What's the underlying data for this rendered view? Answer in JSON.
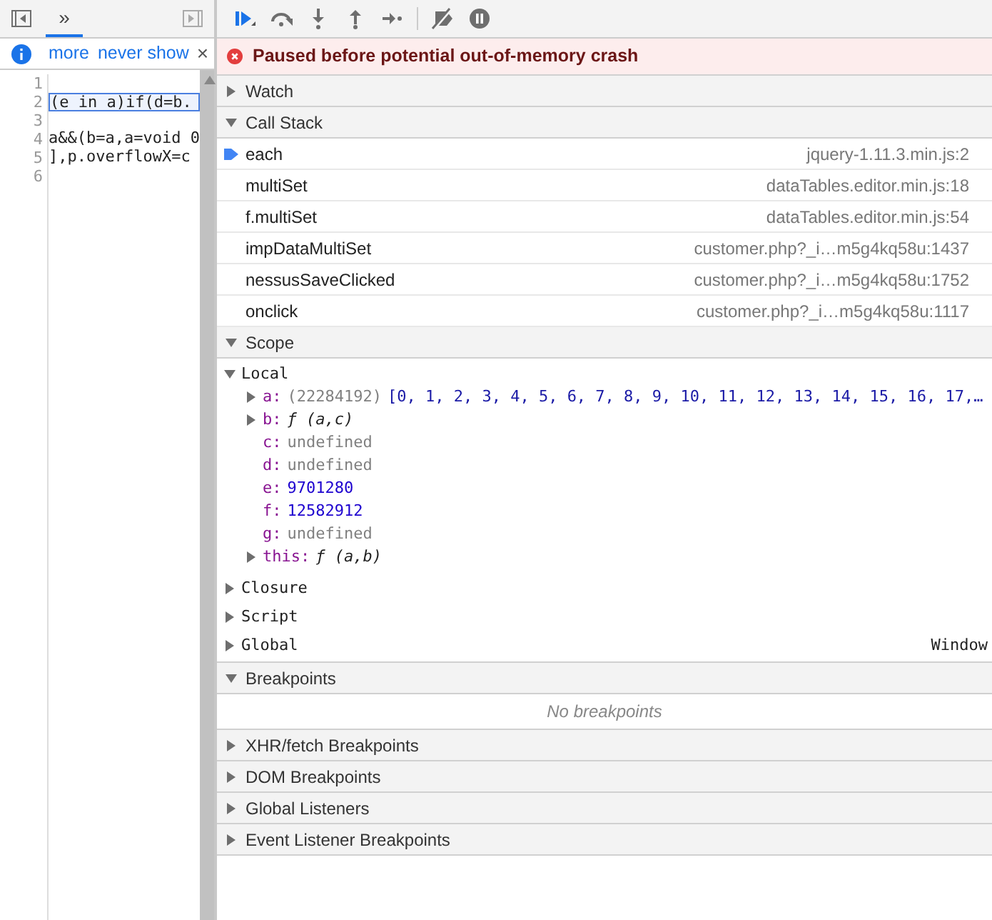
{
  "navigator": {
    "more_tabs": "»"
  },
  "info_bar": {
    "links": [
      "more",
      "never show"
    ],
    "close": "×"
  },
  "code": {
    "lines": [
      {
        "number": "1",
        "selected": false
      },
      {
        "number": "2",
        "text": "(e in a)if(d=b.",
        "selected": true
      },
      {
        "number": "3",
        "selected": false
      },
      {
        "number": "4",
        "text": "a&&(b=a,a=void 0",
        "selected": false
      },
      {
        "number": "5",
        "text": "],p.overflowX=c",
        "selected": false
      },
      {
        "number": "6",
        "selected": false
      }
    ]
  },
  "pause_banner": "Paused before potential out-of-memory crash",
  "sections": [
    {
      "kind": "plain",
      "title": "Watch",
      "expanded": false
    },
    {
      "kind": "call_stack",
      "title": "Call Stack",
      "expanded": true,
      "frames": [
        {
          "name": "each",
          "location": "jquery-1.11.3.min.js:2",
          "selected": true
        },
        {
          "name": "multiSet",
          "location": "dataTables.editor.min.js:18",
          "selected": false
        },
        {
          "name": "f.multiSet",
          "location": "dataTables.editor.min.js:54",
          "selected": false
        },
        {
          "name": "impDataMultiSet",
          "location": "customer.php?_i…m5g4kq58u:1437",
          "selected": false
        },
        {
          "name": "nessusSaveClicked",
          "location": "customer.php?_i…m5g4kq58u:1752",
          "selected": false
        },
        {
          "name": "onclick",
          "location": "customer.php?_i…m5g4kq58u:1117",
          "selected": false
        }
      ]
    },
    {
      "kind": "scope",
      "title": "Scope",
      "expanded": true,
      "scopes": [
        {
          "name": "Local",
          "expanded": true,
          "variables": [
            {
              "name": "a:",
              "kind": "array",
              "expandable": true,
              "count": "(22284192)",
              "value": "[0, 1, 2, 3, 4, 5, 6, 7, 8, 9, 10, 11, 12, 13, 14, 15, 16, 17,…"
            },
            {
              "name": "b:",
              "kind": "function",
              "expandable": true,
              "value": "ƒ (a,c)"
            },
            {
              "name": "c:",
              "kind": "undefined",
              "expandable": false,
              "value": "undefined"
            },
            {
              "name": "d:",
              "kind": "undefined",
              "expandable": false,
              "value": "undefined"
            },
            {
              "name": "e:",
              "kind": "number",
              "expandable": false,
              "value": "9701280"
            },
            {
              "name": "f:",
              "kind": "number",
              "expandable": false,
              "value": "12582912"
            },
            {
              "name": "g:",
              "kind": "undefined",
              "expandable": false,
              "value": "undefined"
            },
            {
              "name": "this:",
              "kind": "function",
              "expandable": true,
              "value": "ƒ (a,b)"
            }
          ]
        },
        {
          "name": "Closure",
          "expanded": false
        },
        {
          "name": "Script",
          "expanded": false
        },
        {
          "name": "Global",
          "expanded": false,
          "value": "Window"
        }
      ]
    },
    {
      "kind": "breakpoints",
      "title": "Breakpoints",
      "expanded": true,
      "empty_message": "No breakpoints"
    },
    {
      "kind": "plain",
      "title": "XHR/fetch Breakpoints",
      "expanded": false
    },
    {
      "kind": "plain",
      "title": "DOM Breakpoints",
      "expanded": false
    },
    {
      "kind": "plain",
      "title": "Global Listeners",
      "expanded": false
    },
    {
      "kind": "plain",
      "title": "Event Listener Breakpoints",
      "expanded": false
    }
  ]
}
